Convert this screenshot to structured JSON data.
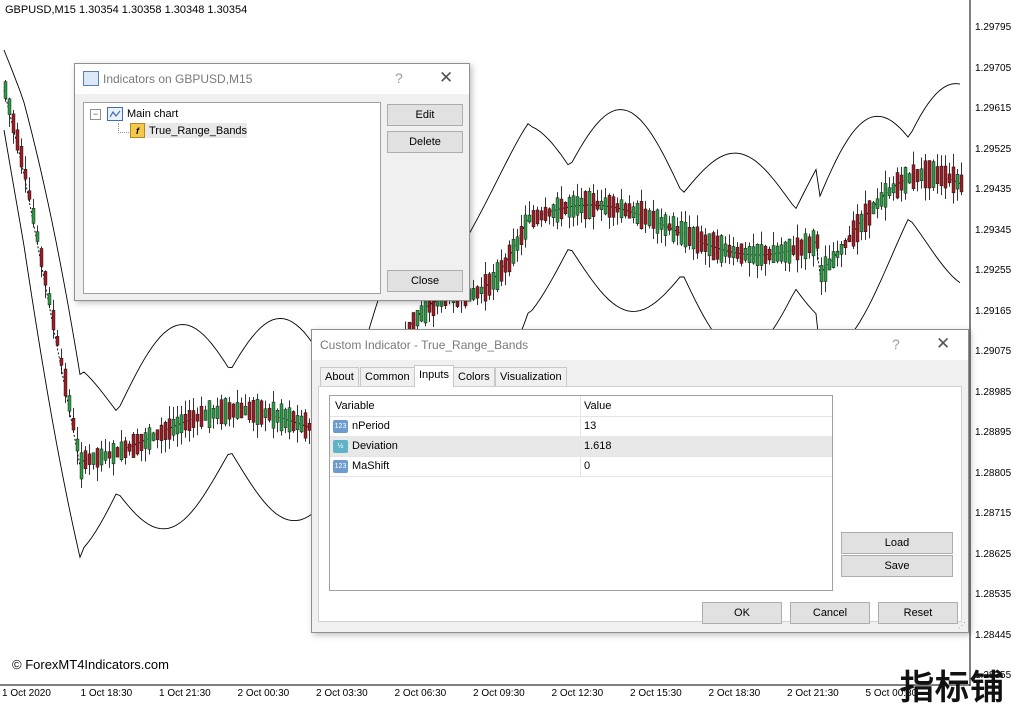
{
  "chart": {
    "header": "GBPUSD,M15  1.30354 1.30358 1.30348 1.30354",
    "price_labels": [
      "1.29795",
      "1.29705",
      "1.29615",
      "1.29525",
      "1.29435",
      "1.29345",
      "1.29255",
      "1.29165",
      "1.29075",
      "1.28985",
      "1.28895",
      "1.28805",
      "1.28715",
      "1.28625",
      "1.28535",
      "1.28445",
      "1.28355"
    ],
    "time_labels": [
      "1 Oct 2020",
      "1 Oct 18:30",
      "1 Oct 21:30",
      "2 Oct 00:30",
      "2 Oct 03:30",
      "2 Oct 06:30",
      "2 Oct 09:30",
      "2 Oct 12:30",
      "2 Oct 15:30",
      "2 Oct 18:30",
      "2 Oct 21:30",
      "5 Oct 00:30"
    ],
    "copyright": "© ForexMT4Indicators.com",
    "watermark": "指标铺",
    "colors": {
      "bull": "#2e9b46",
      "bear": "#9e1f23",
      "band": "#000000"
    }
  },
  "indicators_dialog": {
    "title": "Indicators on GBPUSD,M15",
    "help": "?",
    "close_glyph": "✕",
    "tree": {
      "root": "Main chart",
      "child": "True_Range_Bands"
    },
    "buttons": {
      "edit": "Edit",
      "delete": "Delete",
      "close": "Close"
    }
  },
  "custom_dialog": {
    "title": "Custom Indicator - True_Range_Bands",
    "help": "?",
    "close_glyph": "✕",
    "tabs": [
      "About",
      "Common",
      "Inputs",
      "Colors",
      "Visualization"
    ],
    "active_tab": "Inputs",
    "grid": {
      "headers": {
        "variable": "Variable",
        "value": "Value"
      },
      "rows": [
        {
          "type": "123",
          "variable": "nPeriod",
          "value": "13"
        },
        {
          "type": "½",
          "variable": "Deviation",
          "value": "1.618"
        },
        {
          "type": "123",
          "variable": "MaShift",
          "value": "0"
        }
      ]
    },
    "buttons": {
      "load": "Load",
      "save": "Save",
      "ok": "OK",
      "cancel": "Cancel",
      "reset": "Reset"
    }
  }
}
